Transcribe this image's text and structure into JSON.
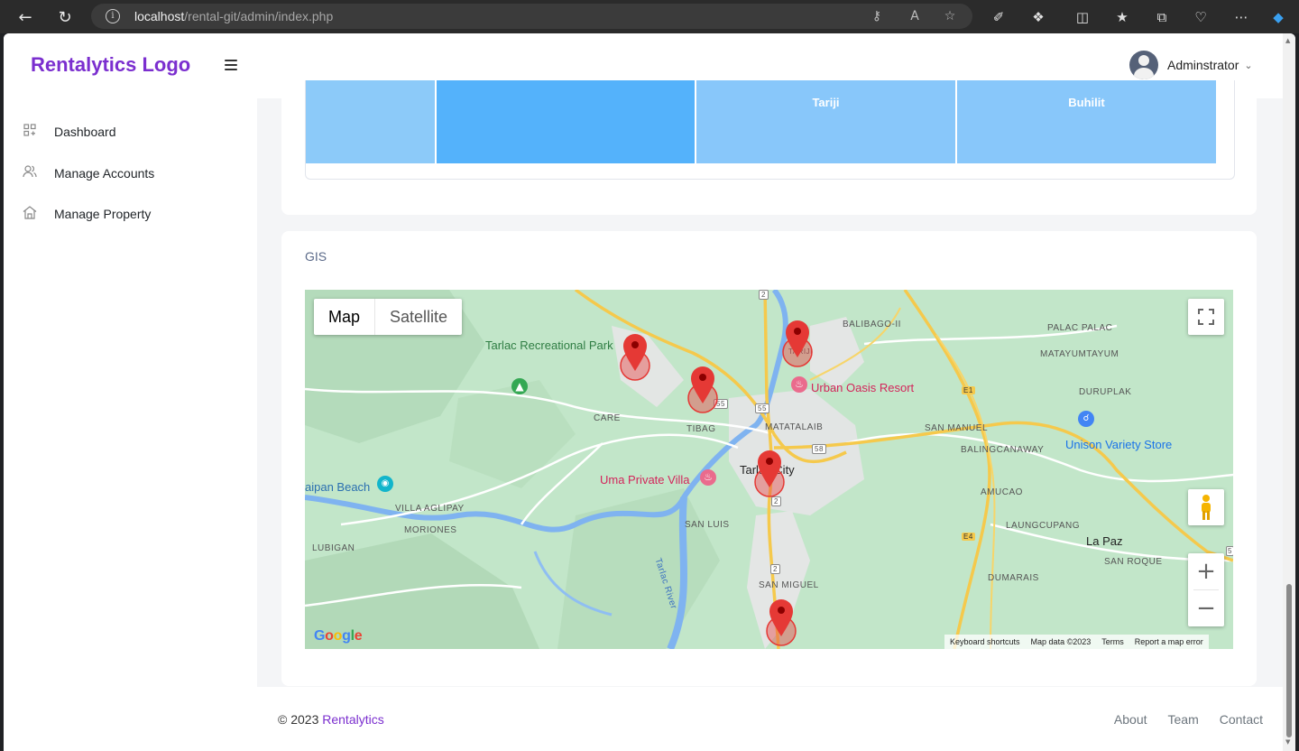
{
  "browser": {
    "url_host": "localhost",
    "url_path": "/rental-git/admin/index.php"
  },
  "header": {
    "logo": "Rentalytics Logo",
    "user_name": "Adminstrator"
  },
  "sidebar": {
    "items": [
      {
        "label": "Dashboard",
        "icon": "grid-icon"
      },
      {
        "label": "Manage Accounts",
        "icon": "users-icon"
      },
      {
        "label": "Manage Property",
        "icon": "home-icon"
      }
    ]
  },
  "treemap": {
    "tiles": [
      {
        "label": "",
        "color": "#8ccaf9"
      },
      {
        "label": "",
        "color": "#54b2fb"
      },
      {
        "label": "Tariji",
        "color": "#88c7fa"
      },
      {
        "label": "Buhilit",
        "color": "#88c7fa"
      }
    ]
  },
  "gis": {
    "title": "GIS",
    "map_type": {
      "map": "Map",
      "satellite": "Satellite"
    },
    "places": {
      "tarlac_rec_park": "Tarlac Recreational Park",
      "urban_oasis": "Urban Oasis Resort",
      "uma_villa": "Uma Private Villa",
      "unison": "Unison Variety Store",
      "beach": "aipan Beach",
      "tarlac_city": "Tarlac City",
      "la_paz": "La Paz",
      "balibago": "BALIBAGO-II",
      "palac_palac": "PALAC PALAC",
      "matayumtayum": "MATAYUMTAYUM",
      "duruplak": "DURUPLAK",
      "care": "CARE",
      "tibag": "TIBAG",
      "matatalaib": "MATATALAIB",
      "san_manuel": "SAN MANUEL",
      "balingcanaway": "BALINGCANAWAY",
      "villa_aglipay": "VILLA AGLIPAY",
      "moriones": "MORIONES",
      "lubigan": "LUBIGAN",
      "san_luis": "SAN LUIS",
      "amucao": "AMUCAO",
      "laungcupang": "LAUNGCUPANG",
      "san_roque": "SAN ROQUE",
      "san_miguel": "SAN MIGUEL",
      "dumarais": "DUMARAIS",
      "tarlac_river": "Tarlac River",
      "tariji_small": "TARIJI"
    },
    "attribution": {
      "keyboard": "Keyboard shortcuts",
      "mapdata": "Map data ©2023",
      "terms": "Terms",
      "report": "Report a map error"
    },
    "google": "Google",
    "route_badges": [
      "2",
      "55",
      "58",
      "2",
      "2",
      "E1",
      "E4",
      "5"
    ]
  },
  "footer": {
    "copyright": "© 2023 ",
    "brand": "Rentalytics",
    "links": [
      "About",
      "Team",
      "Contact"
    ]
  }
}
